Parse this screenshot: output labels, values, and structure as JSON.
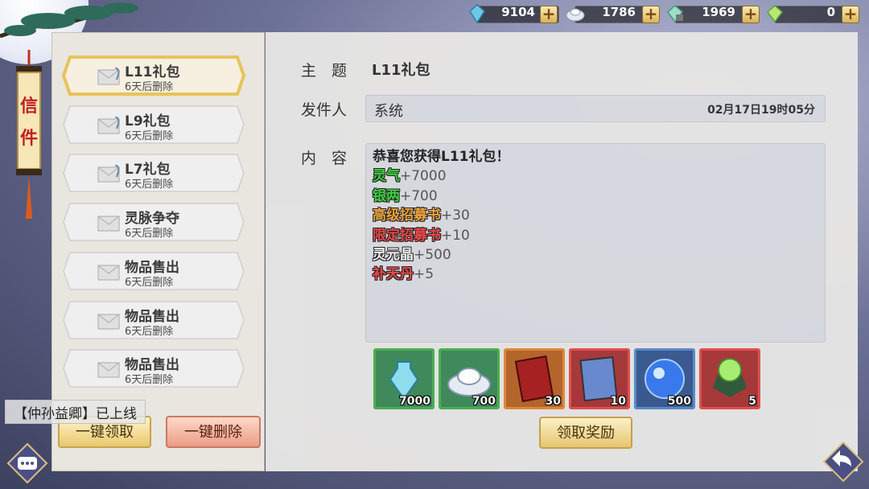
{
  "currencies": [
    {
      "icon": "spirit-crystal-icon",
      "value": "9104"
    },
    {
      "icon": "silver-ingot-icon",
      "value": "1786"
    },
    {
      "icon": "locked-gem-icon",
      "value": "1969"
    },
    {
      "icon": "rainbow-gem-icon",
      "value": "0"
    }
  ],
  "side_tab": {
    "label_1": "信",
    "label_2": "件"
  },
  "mail_list": [
    {
      "title": "L11礼包",
      "subtitle": "6天后删除",
      "selected": true,
      "has_attachment": true
    },
    {
      "title": "L9礼包",
      "subtitle": "6天后删除",
      "selected": false,
      "has_attachment": true
    },
    {
      "title": "L7礼包",
      "subtitle": "6天后删除",
      "selected": false,
      "has_attachment": true
    },
    {
      "title": "灵脉争夺",
      "subtitle": "6天后删除",
      "selected": false,
      "has_attachment": false
    },
    {
      "title": "物品售出",
      "subtitle": "6天后删除",
      "selected": false,
      "has_attachment": false
    },
    {
      "title": "物品售出",
      "subtitle": "6天后删除",
      "selected": false,
      "has_attachment": false
    },
    {
      "title": "物品售出",
      "subtitle": "6天后删除",
      "selected": false,
      "has_attachment": false
    }
  ],
  "actions": {
    "claim_all": "一键领取",
    "delete_all": "一键删除",
    "claim_reward": "领取奖励"
  },
  "notice": "【仲孙益卿】已上线",
  "detail": {
    "subject_label": "主　题",
    "subject": "L11礼包",
    "sender_label": "发件人",
    "sender": "系统",
    "time": "02月17日19时05分",
    "content_label": "内　容",
    "content_heading": "恭喜您获得L11礼包！",
    "content_lines": [
      {
        "name": "灵气",
        "amount": "+7000",
        "color": "#3cd23c"
      },
      {
        "name": "银两",
        "amount": "+700",
        "color": "#3cd23c"
      },
      {
        "name": "高级招募书",
        "amount": "+30",
        "color": "#f0a23a"
      },
      {
        "name": "限定招募书",
        "amount": "+10",
        "color": "#f04848"
      },
      {
        "name": "灵元晶",
        "amount": "+500",
        "color": "#f4f4f4"
      },
      {
        "name": "补天丹",
        "amount": "+5",
        "color": "#f04848"
      }
    ]
  },
  "rewards": [
    {
      "icon": "spirit-bottle-icon",
      "count": "7000",
      "frame": "#4caf50"
    },
    {
      "icon": "silver-ingot-icon",
      "count": "700",
      "frame": "#4caf50"
    },
    {
      "icon": "red-recruit-book-icon",
      "count": "30",
      "frame": "#e08a3c"
    },
    {
      "icon": "limited-recruit-book-icon",
      "count": "10",
      "frame": "#e05050"
    },
    {
      "icon": "blue-crystal-orb-icon",
      "count": "500",
      "frame": "#5a8ac8"
    },
    {
      "icon": "green-pill-icon",
      "count": "5",
      "frame": "#e05050"
    }
  ]
}
